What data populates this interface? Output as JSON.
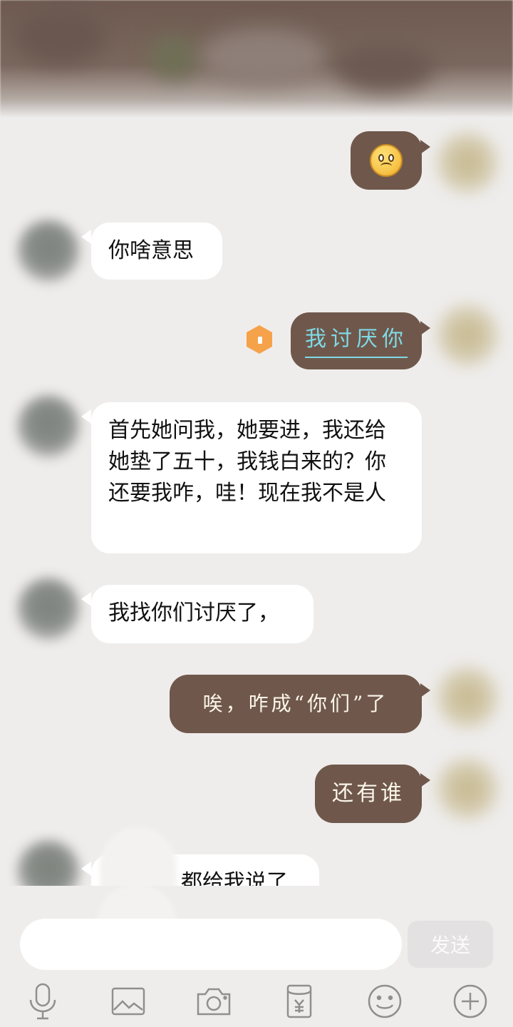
{
  "header": {
    "title": ""
  },
  "messages": [
    {
      "side": "out",
      "type": "emoji",
      "icon": "sad-face-emoji"
    },
    {
      "side": "in",
      "text": "你啥意思"
    },
    {
      "side": "out",
      "text": "我讨厌你",
      "style": "link"
    },
    {
      "side": "in",
      "text": "首先她问我，她要进，我还给她垫了五十，我钱白来的？你还要我咋，哇！现在我不是人"
    },
    {
      "side": "in",
      "text": "我找你们讨厌了，"
    },
    {
      "side": "out",
      "text": "唉，咋成“你们”了"
    },
    {
      "side": "out",
      "text": "还有谁"
    },
    {
      "side": "in",
      "text": "都给我说了",
      "partial": true
    }
  ],
  "input": {
    "placeholder": "",
    "value": ""
  },
  "send_button": {
    "label": "发送"
  },
  "toolbar": {
    "icons": [
      "microphone-icon",
      "image-icon",
      "camera-icon",
      "red-packet-icon",
      "emoji-icon",
      "plus-icon"
    ]
  },
  "colors": {
    "background": "#efedec",
    "incoming_bubble": "#ffffff",
    "outgoing_bubble": "#6f584b",
    "outgoing_text": "#fbf5ea",
    "link_text": "#7fd9e6",
    "send_button": "#e3e1e1"
  }
}
